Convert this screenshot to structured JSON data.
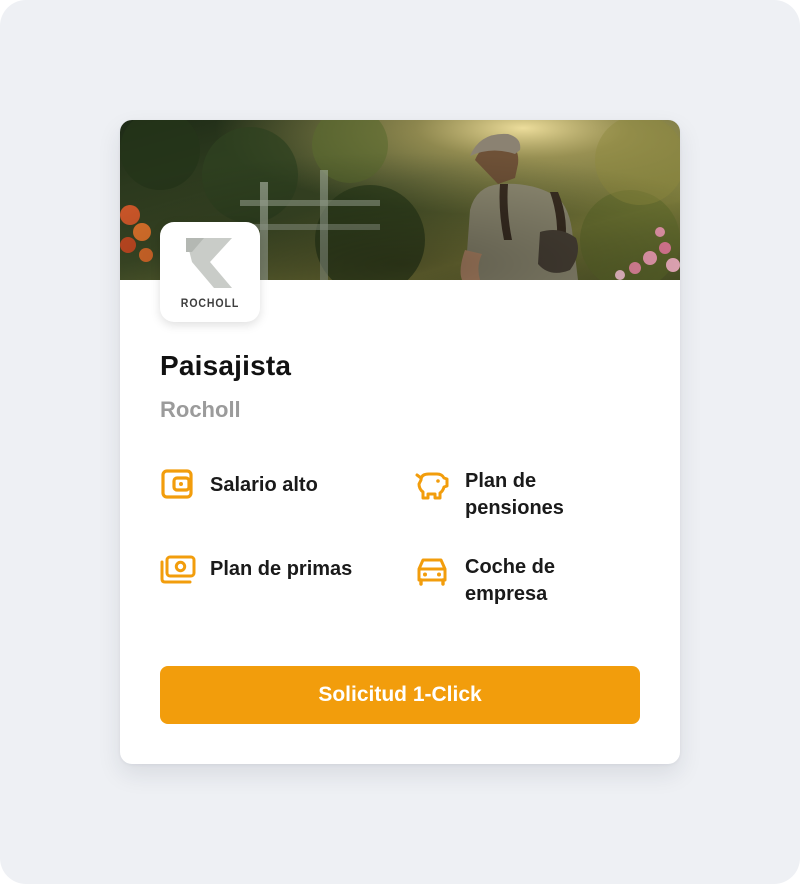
{
  "job": {
    "title": "Paisajista",
    "company": "Rocholl",
    "logo_text": "ROCHOLL",
    "hero_image": "landscaper-in-garden-photo"
  },
  "benefits": [
    {
      "icon": "wallet-icon",
      "label": "Salario alto"
    },
    {
      "icon": "piggy-bank-icon",
      "label": "Plan de pensiones"
    },
    {
      "icon": "money-stack-icon",
      "label": "Plan de primas"
    },
    {
      "icon": "car-icon",
      "label": "Coche de empresa"
    }
  ],
  "apply_button": {
    "label": "Solicitud 1-Click"
  },
  "colors": {
    "accent": "#f29d0c",
    "background": "#eef0f4",
    "card": "#ffffff",
    "title_text": "#111111",
    "muted_text": "#9b9b9b"
  }
}
